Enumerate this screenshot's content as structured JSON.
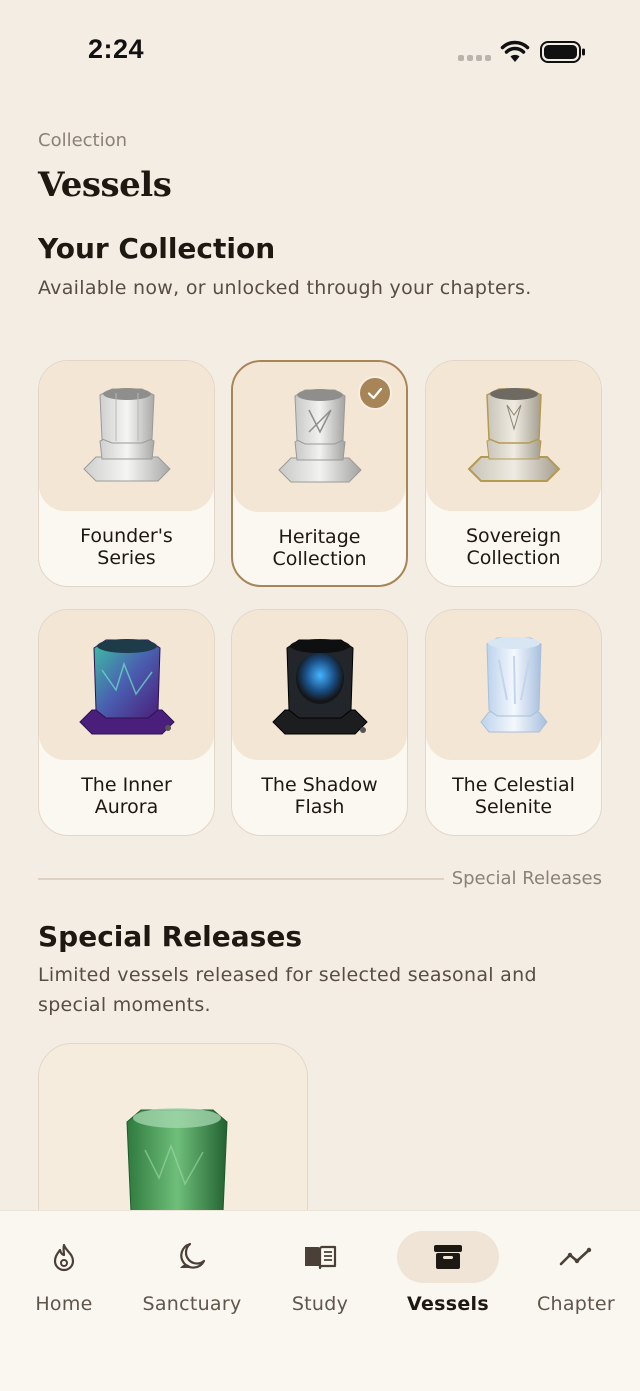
{
  "status_bar": {
    "time": "2:24"
  },
  "header": {
    "eyebrow": "Collection",
    "title": "Vessels"
  },
  "collection": {
    "title": "Your Collection",
    "subtitle": "Available now, or unlocked through your chapters.",
    "items": [
      {
        "name": "Founder's\nSeries",
        "style": "marble",
        "selected": false
      },
      {
        "name": "Heritage\nCollection",
        "style": "marble",
        "selected": true
      },
      {
        "name": "Sovereign\nCollection",
        "style": "gold",
        "selected": false
      },
      {
        "name": "The Inner\nAurora",
        "style": "aurora",
        "selected": false
      },
      {
        "name": "The Shadow\nFlash",
        "style": "shadow",
        "selected": false
      },
      {
        "name": "The Celestial\nSelenite",
        "style": "selenite",
        "selected": false
      }
    ]
  },
  "divider": {
    "label": "Special Releases"
  },
  "special": {
    "title": "Special Releases",
    "subtitle_line1": "Limited vessels released for selected seasonal and",
    "subtitle_line2": "special moments."
  },
  "tabs": [
    {
      "label": "Home",
      "icon": "flame-icon",
      "active": false
    },
    {
      "label": "Sanctuary",
      "icon": "moon-icon",
      "active": false
    },
    {
      "label": "Study",
      "icon": "book-icon",
      "active": false
    },
    {
      "label": "Vessels",
      "icon": "archive-box-icon",
      "active": true
    },
    {
      "label": "Chapter",
      "icon": "trend-line-icon",
      "active": false
    }
  ],
  "colors": {
    "background": "#f4ede4",
    "accent": "#a88556",
    "card_art": "#f3e6d5"
  }
}
